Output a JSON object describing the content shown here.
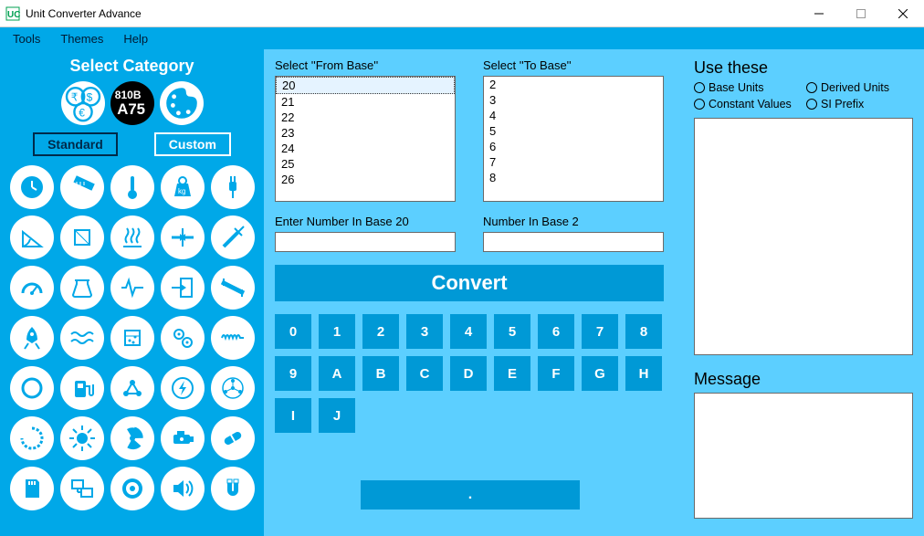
{
  "window": {
    "title": "Unit Converter Advance"
  },
  "menu": {
    "items": [
      "Tools",
      "Themes",
      "Help"
    ]
  },
  "sidebar": {
    "title": "Select Category",
    "modes": {
      "standard": "Standard",
      "custom": "Custom"
    },
    "top_icons": [
      "currency-icon",
      "basenum-icon",
      "palette-icon"
    ],
    "categories": [
      "clock-icon",
      "ruler-icon",
      "thermometer-icon",
      "weight-icon",
      "plug-icon",
      "angle-icon",
      "area-icon",
      "heatwave-icon",
      "compress-icon",
      "injection-icon",
      "speedometer-icon",
      "beaker-icon",
      "pulse-icon",
      "login-icon",
      "resistor-icon",
      "rocket-icon",
      "waves-icon",
      "flask-icon",
      "gears-icon",
      "inductor-icon",
      "circle-icon",
      "fuel-icon",
      "molecule-icon",
      "bolt-circle-icon",
      "network-icon",
      "loading-icon",
      "sun-icon",
      "radiation-icon",
      "engine-icon",
      "pill-icon",
      "sdcard-icon",
      "computers-icon",
      "disc-icon",
      "speaker-icon",
      "magnet-icon"
    ]
  },
  "middle": {
    "from_label": "Select ''From Base''",
    "to_label": "Select ''To Base''",
    "from_items": [
      "20",
      "21",
      "22",
      "23",
      "24",
      "25",
      "26"
    ],
    "to_items": [
      "2",
      "3",
      "4",
      "5",
      "6",
      "7",
      "8"
    ],
    "enter_label": "Enter Number In Base 20",
    "result_label": "Number In Base 2",
    "convert": "Convert",
    "keys": [
      "0",
      "1",
      "2",
      "3",
      "4",
      "5",
      "6",
      "7",
      "8",
      "9",
      "A",
      "B",
      "C",
      "D",
      "E",
      "F",
      "G",
      "H",
      "I",
      "J"
    ],
    "bottom_bar": "."
  },
  "right": {
    "use_title": "Use these",
    "radios": [
      "Base Units",
      "Derived Units",
      "Constant Values",
      "SI Prefix"
    ],
    "msg_title": "Message"
  }
}
